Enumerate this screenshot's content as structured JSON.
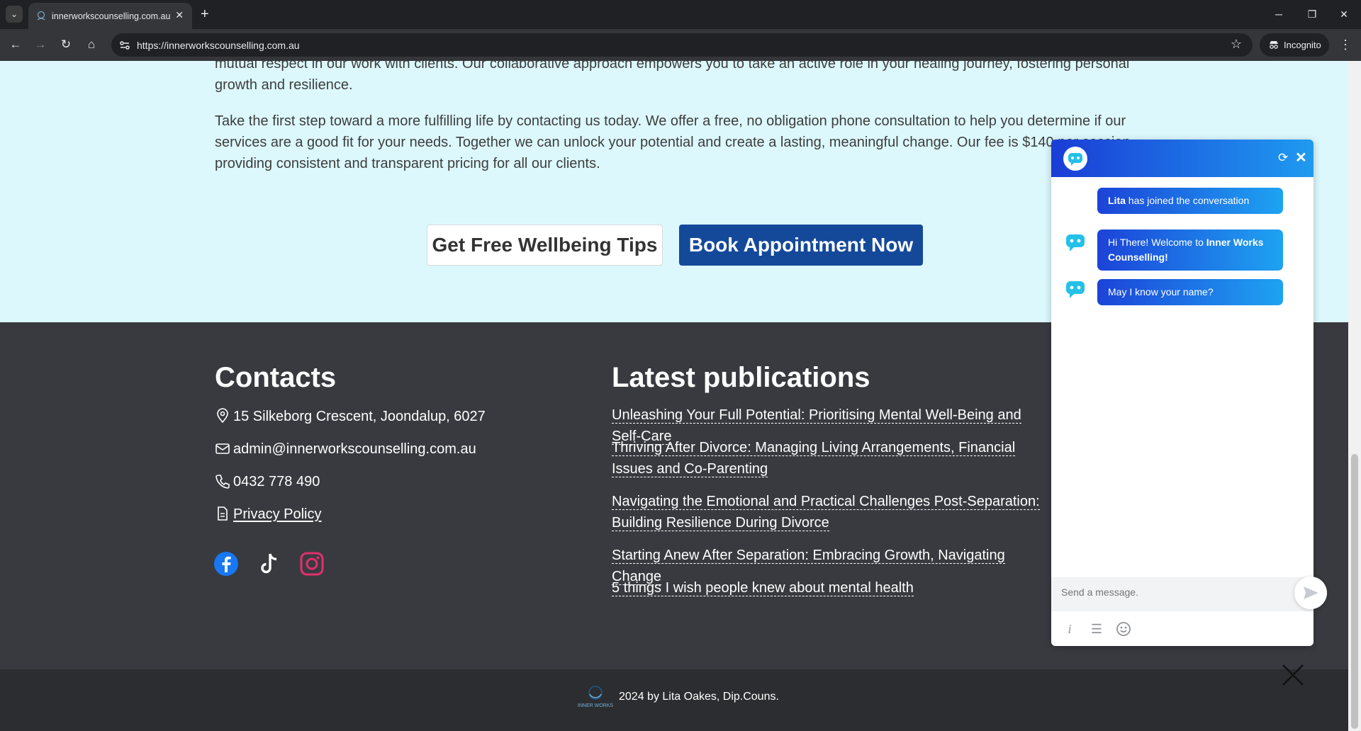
{
  "browser": {
    "tab_title": "innerworkscounselling.com.au",
    "tab_close": "✕",
    "new_tab": "+",
    "url": "https://innerworkscounselling.com.au",
    "mode_label": "Incognito"
  },
  "page": {
    "intro_text": "mutual respect in our work with clients. Our collaborative approach empowers you to take an active role in your healing journey, fostering personal growth and resilience.",
    "cta_text": "Take the first step toward a more fulfilling life by contacting us today. We offer a free, no obligation phone consultation to help you determine if our services are a good fit for your needs. Together we can unlock your potential and create a lasting, meaningful change. Our fee is $140 per session, providing consistent and transparent pricing for all our clients.",
    "btn_tips": "Get Free Wellbeing Tips",
    "btn_book": "Book Appointment Now"
  },
  "footer": {
    "contacts_heading": "Contacts",
    "address": "15 Silkeborg Crescent, Joondalup, 6027",
    "email": "admin@innerworkscounselling.com.au",
    "phone": "0432 778 490",
    "privacy": "Privacy Policy",
    "publications_heading": "Latest publications",
    "publications": [
      "Unleashing Your Full Potential: Prioritising Mental Well-Being and Self-Care",
      "Thriving After Divorce: Managing Living Arrangements, Financial Issues and Co-Parenting",
      "Navigating the Emotional and Practical Challenges Post-Separation: Building Resilience During Divorce",
      "Starting Anew After Separation: Embracing Growth, Navigating Change",
      "5 things I wish people knew about mental health"
    ],
    "logo_text": "INNER WORKS",
    "copyright": "2024 by Lita Oakes, Dip.Couns."
  },
  "chat": {
    "joined_name": "Lita",
    "joined_rest": " has joined the conversation",
    "welcome_prefix": "Hi There! Welcome to ",
    "welcome_brand": "Inner Works Counselling!",
    "question": "May I know your name?",
    "input_placeholder": "Send a message.",
    "refresh_glyph": "⟳",
    "close_glyph": "✕",
    "tool_info": "i",
    "tool_menu": "☰"
  },
  "colors": {
    "hero_bg": "#dcf8fd",
    "footer_bg": "#393a3f",
    "book_button": "#14499a",
    "chat_gradient_start": "#1a3dd6",
    "chat_gradient_end": "#1ea3f2",
    "facebook": "#1877f2",
    "instagram": "#e1306c"
  },
  "icons": [
    "tab-list-icon",
    "back-icon",
    "forward-icon",
    "reload-icon",
    "home-icon",
    "site-info-icon",
    "star-icon",
    "incognito-icon",
    "menu-icon",
    "location-icon",
    "mail-icon",
    "phone-icon",
    "document-icon",
    "facebook-icon",
    "tiktok-icon",
    "instagram-icon",
    "chat-bot-icon",
    "send-icon",
    "info-icon",
    "menu-lines-icon",
    "emoji-icon",
    "close-icon"
  ]
}
